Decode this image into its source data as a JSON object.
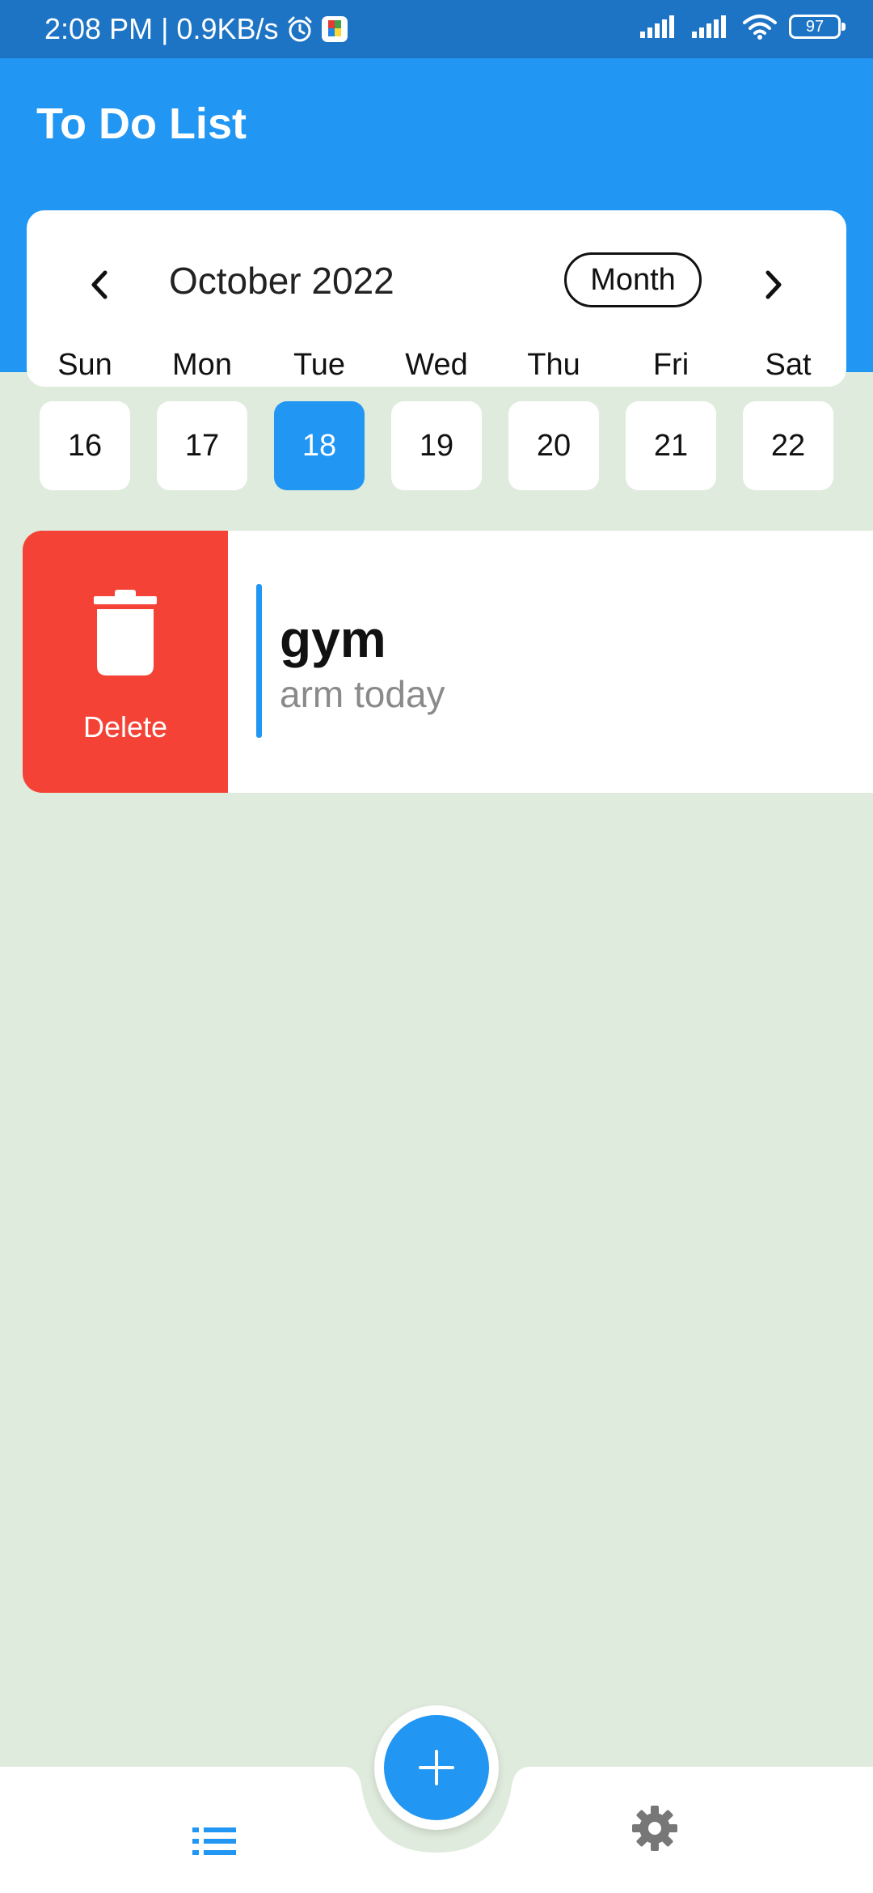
{
  "status_bar": {
    "time_speed": "2:08 PM | 0.9KB/s",
    "battery": "97",
    "icons": [
      "alarm-icon",
      "app-notification-icon",
      "signal-icon",
      "signal-icon",
      "wifi-icon",
      "battery-icon"
    ]
  },
  "app_bar": {
    "title": "To Do List",
    "color": "#2196f3"
  },
  "calendar": {
    "month_label": "October 2022",
    "view_mode": "Month",
    "weekdays": [
      "Sun",
      "Mon",
      "Tue",
      "Wed",
      "Thu",
      "Fri",
      "Sat"
    ],
    "dates": [
      "16",
      "17",
      "18",
      "19",
      "20",
      "21",
      "22"
    ],
    "selected_date": "18"
  },
  "tasks": [
    {
      "title": "gym",
      "note": "arm today",
      "accent_color": "#2196f3",
      "action_label": "Delete",
      "action_color": "#f44336"
    }
  ],
  "bottom_nav": {
    "items": [
      "list-icon",
      "settings-icon"
    ],
    "fab_icon": "plus-icon"
  },
  "colors": {
    "background": "#dfebdc",
    "accent": "#2196f3",
    "danger": "#f44336"
  }
}
